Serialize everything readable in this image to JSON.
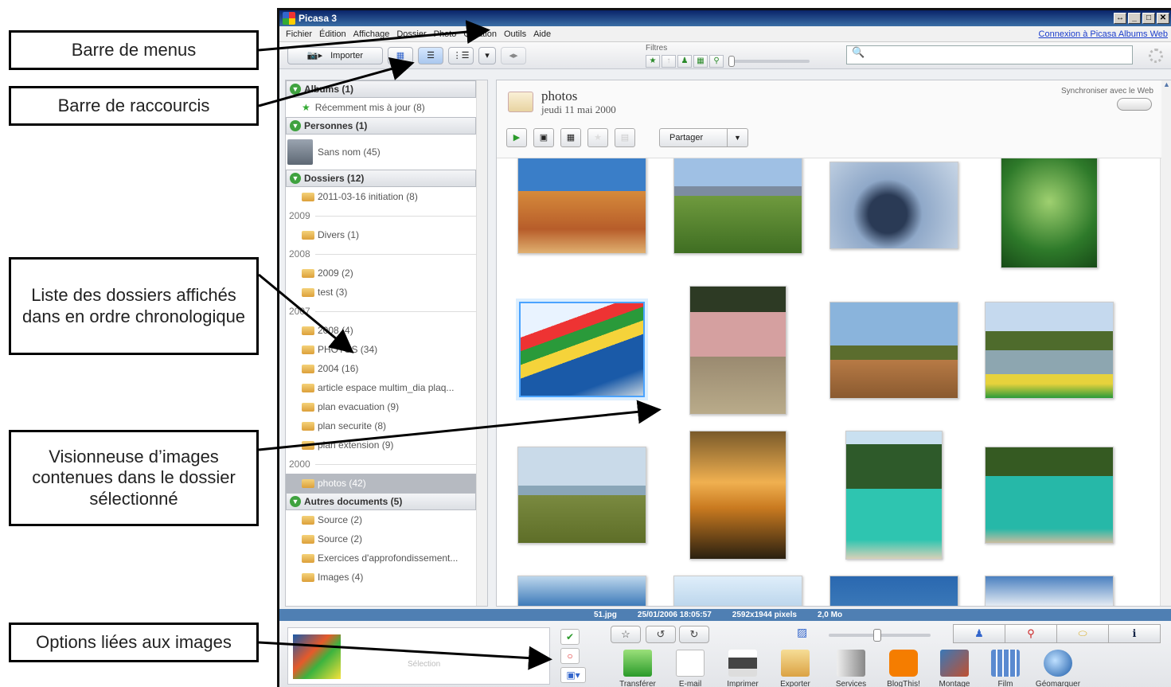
{
  "callouts": {
    "menus": "Barre de menus",
    "shortcuts": "Barre de raccourcis",
    "folders": "Liste des dossiers affichés dans en ordre chronologique",
    "viewer": "Visionneuse d’images contenues dans le dossier sélectionné",
    "options": "Options liées aux images"
  },
  "window": {
    "title": "Picasa 3"
  },
  "menu": {
    "items": [
      "Fichier",
      "Édition",
      "Affichage",
      "Dossier",
      "Photo",
      "Création",
      "Outils",
      "Aide"
    ],
    "web_link": "Connexion à Picasa Albums Web"
  },
  "toolbar": {
    "import_label": "Importer",
    "filters_label": "Filtres",
    "search_placeholder": ""
  },
  "sidebar": {
    "albums": {
      "label": "Albums (1)",
      "items": [
        "Récemment mis à jour (8)"
      ]
    },
    "people": {
      "label": "Personnes (1)",
      "items": [
        "Sans nom (45)"
      ]
    },
    "folders": {
      "label": "Dossiers (12)",
      "f1": "2011-03-16 initiation (8)",
      "y2009": "2009",
      "f2": "Divers (1)",
      "y2008": "2008",
      "f3": "2009 (2)",
      "f4": "test (3)",
      "y2007": "2007",
      "f5": "2008 (4)",
      "f6": "PHOTOS (34)",
      "f7": "2004 (16)",
      "f8": "article espace multim_dia plaq...",
      "f9": "plan evacuation (9)",
      "f10": "plan securite (8)",
      "f11": "plan extension (9)",
      "y2000": "2000",
      "f12": "photos (42)"
    },
    "other": {
      "label": "Autres documents (5)",
      "o1": "Source (2)",
      "o2": "Source (2)",
      "o3": "Exercices d'approfondissement...",
      "o4": "Images (4)"
    }
  },
  "folder_view": {
    "title": "photos",
    "date": "jeudi 11 mai 2000",
    "sync_label": "Synchroniser avec le Web",
    "share_label": "Partager"
  },
  "status": {
    "filename": "51.jpg",
    "datetime": "25/01/2006 18:05:57",
    "dimensions": "2592x1944 pixels",
    "size": "2,0 Mo"
  },
  "tray": {
    "label": "Sélection"
  },
  "tools": [
    "Transférer",
    "E-mail",
    "Imprimer",
    "Exporter",
    "Services",
    "BlogThis!",
    "Montage",
    "Film",
    "Géomarquer"
  ]
}
